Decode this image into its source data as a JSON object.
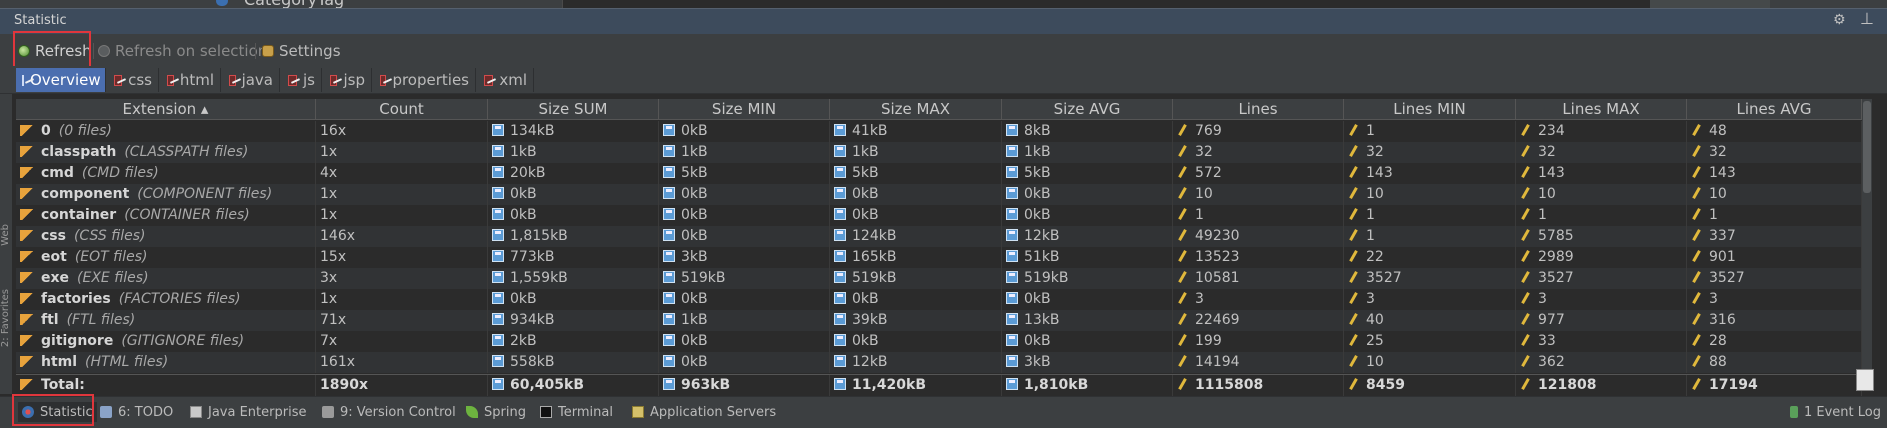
{
  "background": {
    "breadcrumb": "CategoryTag"
  },
  "window": {
    "title": "Statistic"
  },
  "toolbar": {
    "refresh": "Refresh",
    "refresh_on_selection": "Refresh on selection",
    "settings": "Settings"
  },
  "tabs": [
    "Overview",
    "css",
    "html",
    "java",
    "js",
    "jsp",
    "properties",
    "xml"
  ],
  "active_tab": "Overview",
  "table": {
    "columns": [
      "Extension ▴",
      "Count",
      "Size SUM",
      "Size MIN",
      "Size MAX",
      "Size AVG",
      "Lines",
      "Lines MIN",
      "Lines MAX",
      "Lines AVG"
    ],
    "rows": [
      {
        "ext": "0",
        "type": "(0 files)",
        "count": "16x",
        "size_sum": "134kB",
        "size_min": "0kB",
        "size_max": "41kB",
        "size_avg": "8kB",
        "lines": "769",
        "lines_min": "1",
        "lines_max": "234",
        "lines_avg": "48"
      },
      {
        "ext": "classpath",
        "type": "(CLASSPATH files)",
        "count": "1x",
        "size_sum": "1kB",
        "size_min": "1kB",
        "size_max": "1kB",
        "size_avg": "1kB",
        "lines": "32",
        "lines_min": "32",
        "lines_max": "32",
        "lines_avg": "32"
      },
      {
        "ext": "cmd",
        "type": "(CMD files)",
        "count": "4x",
        "size_sum": "20kB",
        "size_min": "5kB",
        "size_max": "5kB",
        "size_avg": "5kB",
        "lines": "572",
        "lines_min": "143",
        "lines_max": "143",
        "lines_avg": "143"
      },
      {
        "ext": "component",
        "type": "(COMPONENT files)",
        "count": "1x",
        "size_sum": "0kB",
        "size_min": "0kB",
        "size_max": "0kB",
        "size_avg": "0kB",
        "lines": "10",
        "lines_min": "10",
        "lines_max": "10",
        "lines_avg": "10"
      },
      {
        "ext": "container",
        "type": "(CONTAINER files)",
        "count": "1x",
        "size_sum": "0kB",
        "size_min": "0kB",
        "size_max": "0kB",
        "size_avg": "0kB",
        "lines": "1",
        "lines_min": "1",
        "lines_max": "1",
        "lines_avg": "1"
      },
      {
        "ext": "css",
        "type": "(CSS files)",
        "count": "146x",
        "size_sum": "1,815kB",
        "size_min": "0kB",
        "size_max": "124kB",
        "size_avg": "12kB",
        "lines": "49230",
        "lines_min": "1",
        "lines_max": "5785",
        "lines_avg": "337"
      },
      {
        "ext": "eot",
        "type": "(EOT files)",
        "count": "15x",
        "size_sum": "773kB",
        "size_min": "3kB",
        "size_max": "165kB",
        "size_avg": "51kB",
        "lines": "13523",
        "lines_min": "22",
        "lines_max": "2989",
        "lines_avg": "901"
      },
      {
        "ext": "exe",
        "type": "(EXE files)",
        "count": "3x",
        "size_sum": "1,559kB",
        "size_min": "519kB",
        "size_max": "519kB",
        "size_avg": "519kB",
        "lines": "10581",
        "lines_min": "3527",
        "lines_max": "3527",
        "lines_avg": "3527"
      },
      {
        "ext": "factories",
        "type": "(FACTORIES files)",
        "count": "1x",
        "size_sum": "0kB",
        "size_min": "0kB",
        "size_max": "0kB",
        "size_avg": "0kB",
        "lines": "3",
        "lines_min": "3",
        "lines_max": "3",
        "lines_avg": "3"
      },
      {
        "ext": "ftl",
        "type": "(FTL files)",
        "count": "71x",
        "size_sum": "934kB",
        "size_min": "1kB",
        "size_max": "39kB",
        "size_avg": "13kB",
        "lines": "22469",
        "lines_min": "40",
        "lines_max": "977",
        "lines_avg": "316"
      },
      {
        "ext": "gitignore",
        "type": "(GITIGNORE files)",
        "count": "7x",
        "size_sum": "2kB",
        "size_min": "0kB",
        "size_max": "0kB",
        "size_avg": "0kB",
        "lines": "199",
        "lines_min": "25",
        "lines_max": "33",
        "lines_avg": "28"
      },
      {
        "ext": "html",
        "type": "(HTML files)",
        "count": "161x",
        "size_sum": "558kB",
        "size_min": "0kB",
        "size_max": "12kB",
        "size_avg": "3kB",
        "lines": "14194",
        "lines_min": "10",
        "lines_max": "362",
        "lines_avg": "88"
      }
    ],
    "total": {
      "label": "Total:",
      "count": "1890x",
      "size_sum": "60,405kB",
      "size_min": "963kB",
      "size_max": "11,420kB",
      "size_avg": "1,810kB",
      "lines": "1115808",
      "lines_min": "8459",
      "lines_max": "121808",
      "lines_avg": "17194"
    }
  },
  "left_strip": [
    "2: Favorites",
    "Web"
  ],
  "bottom_bar": {
    "statistic": "Statistic",
    "todo": "6: TODO",
    "java_enterprise": "Java Enterprise",
    "version_control": "9: Version Control",
    "spring": "Spring",
    "terminal": "Terminal",
    "app_servers": "Application Servers",
    "event_log": "1 Event Log"
  }
}
